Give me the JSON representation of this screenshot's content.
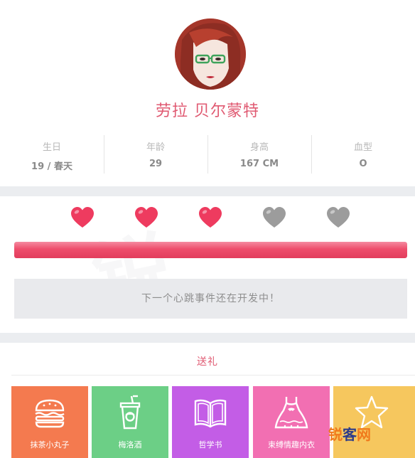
{
  "profile": {
    "name": "劳拉 贝尔蒙特",
    "stats": [
      {
        "label": "生日",
        "value": "19 / 春天"
      },
      {
        "label": "年龄",
        "value": "29"
      },
      {
        "label": "身高",
        "value": "167 CM"
      },
      {
        "label": "血型",
        "value": "O"
      }
    ]
  },
  "affection": {
    "hearts_filled": 3,
    "hearts_total": 5,
    "progress": 1.0,
    "heart_color": "#ee3b5f",
    "heart_empty_color": "#9c9c9c",
    "notice": "下一个心跳事件还在开发中！"
  },
  "gifts": {
    "title": "送礼",
    "items": [
      {
        "label": "抹茶小丸子",
        "icon": "burger-icon",
        "color": "#f47a4f"
      },
      {
        "label": "梅洛酒",
        "icon": "drink-cup-icon",
        "color": "#6ccf86"
      },
      {
        "label": "哲学书",
        "icon": "book-icon",
        "color": "#c35de6"
      },
      {
        "label": "束缚情趣内衣",
        "icon": "dress-icon",
        "color": "#f26fb2"
      },
      {
        "label": "",
        "icon": "star-icon",
        "color": "#f6c75e"
      }
    ]
  },
  "watermark": {
    "brand_1": "锐",
    "brand_2": "客",
    "brand_3": "网"
  }
}
